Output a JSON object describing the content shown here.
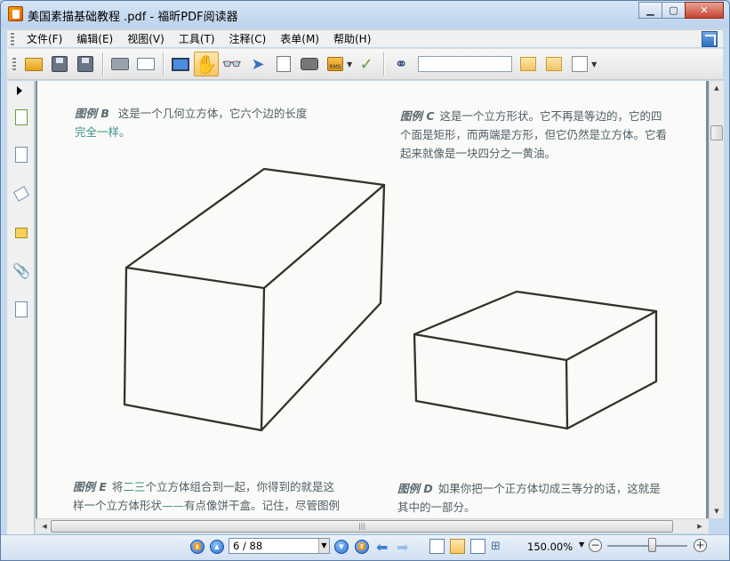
{
  "window": {
    "title": "美国素描基础教程 .pdf - 福昕PDF阅读器",
    "controls": [
      "minimize-icon",
      "maximize-icon",
      "close-icon"
    ]
  },
  "menu": {
    "items": [
      "文件(F)",
      "编辑(E)",
      "视图(V)",
      "工具(T)",
      "注释(C)",
      "表单(M)",
      "帮助(H)"
    ]
  },
  "toolbar": {
    "buttons": [
      "open-folder-icon",
      "save-icon",
      "save-as-icon",
      "print-icon",
      "properties-icon",
      "fullscreen-icon",
      "hand-tool-icon",
      "zoom-glass-icon",
      "select-cursor-icon",
      "text-select-icon",
      "snapshot-camera-icon",
      "rms-lock-icon",
      "sign-check-icon"
    ],
    "rms_label": "RMS",
    "search": {
      "value": "",
      "placeholder": ""
    },
    "active_tool": "hand-tool-icon"
  },
  "page_content": {
    "caption_b": {
      "fig": "图例 B",
      "text": "这是一个几何立方体，它六个边的长度",
      "text2": "完全一样。"
    },
    "caption_c": {
      "fig": "图例 C",
      "line1": "这是一个立方形状。它不再是等边的，它的四",
      "line2": "个面是矩形，而两端是方形，但它仍然是立方体。它看",
      "line3": "起来就像是一块四分之一黄油。"
    },
    "caption_e": {
      "fig": "图例 E",
      "line1a": "将",
      "line1g": "二三",
      "line1b": "个立方体组合到一起，你得到的就是这",
      "line2a": "样一个立方体形状",
      "line2g": "——",
      "line2b": "有点像饼干盒。记住，尽管图例"
    },
    "caption_d": {
      "fig": "图例 D",
      "line1": "如果你把一个正方体切成三等分的话，这就是",
      "line2": "其中的一部分。"
    }
  },
  "statusbar": {
    "page_input": "6 / 88",
    "zoom": "150.00%",
    "zoom_minus": "−",
    "zoom_plus": "+",
    "zoom_slider_level": 0.55
  },
  "colors": {
    "accent": "#3d7fd8",
    "caption_text": "#4f5e66",
    "caption_green": "#3c8f8a"
  }
}
